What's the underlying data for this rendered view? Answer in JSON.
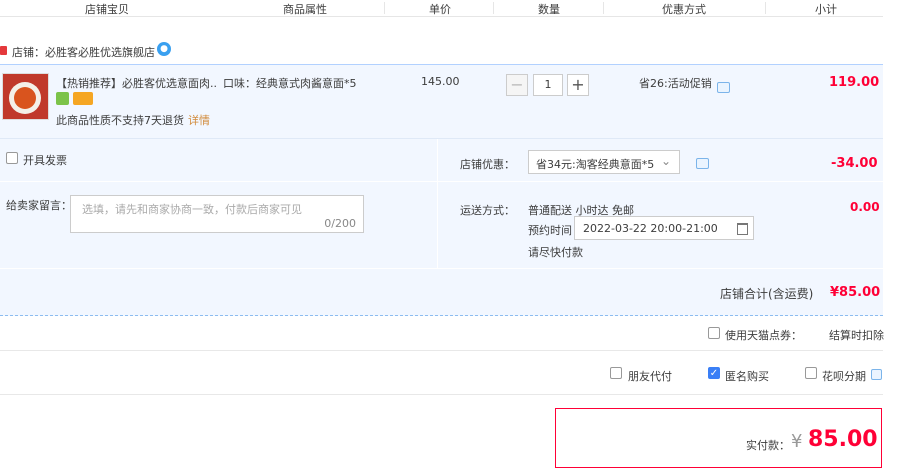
{
  "header": {
    "columns": [
      "店铺宝贝",
      "商品属性",
      "单价",
      "数量",
      "优惠方式",
      "小计"
    ]
  },
  "shop": {
    "label": "店铺：必胜客必胜优选旗舰店"
  },
  "item": {
    "title": "【热销推荐】必胜客优选意面肉...",
    "attribute": "口味：经典意式肉酱意面*5",
    "price": "145.00",
    "quantity": "1",
    "promo": "省26:活动促销",
    "subtotal": "119.00",
    "returns": "此商品性质不支持7天退货",
    "returns_link": "详情"
  },
  "invoice": {
    "label": "开具发票"
  },
  "coupon": {
    "label": "店铺优惠：",
    "selected": "省34元:淘客经典意面*5",
    "amount": "-34.00"
  },
  "memo": {
    "label": "给卖家留言：",
    "placeholder": "选填，请先和商家协商一致，付款后商家可见",
    "count": "0/200"
  },
  "shipping": {
    "label": "运送方式：",
    "method": "普通配送 小时达 免邮",
    "reserve_label": "预约时间",
    "reserve_time": "2022-03-22 20:00-21:00",
    "note": "请尽快付款",
    "fee": "0.00"
  },
  "shop_total": {
    "label": "店铺合计(含运费)",
    "value": "¥85.00"
  },
  "tmall_points": {
    "label": "使用天猫点券：",
    "note": "结算时扣除"
  },
  "options": {
    "friend_pay": "朋友代付",
    "anonymous": "匿名购买",
    "huabei": "花呗分期"
  },
  "payment": {
    "label": "实付款：",
    "currency": "¥",
    "amount": "85.00"
  },
  "colors": {
    "accent": "#ff0036",
    "highlight_bg": "#f2f7ff",
    "checkbox_on": "#3a7ff6"
  }
}
